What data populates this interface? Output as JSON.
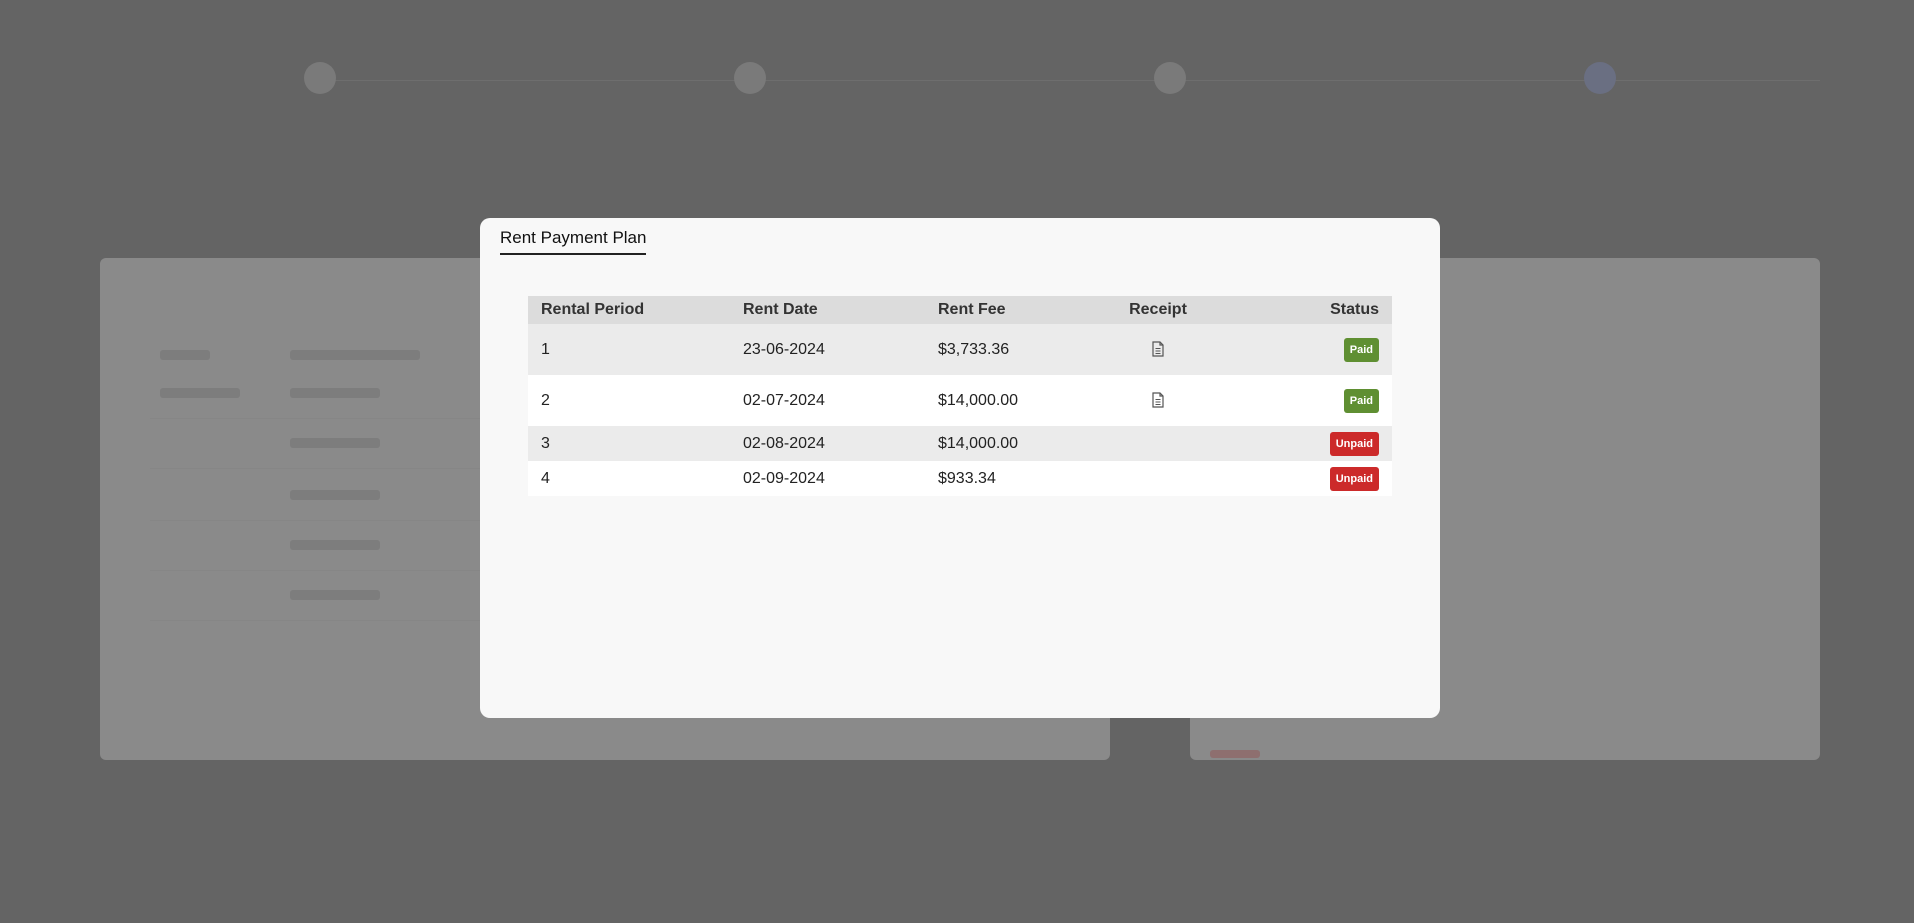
{
  "modal": {
    "title": "Rent Payment Plan"
  },
  "table": {
    "headers": {
      "period": "Rental Period",
      "date": "Rent Date",
      "fee": "Rent Fee",
      "receipt": "Receipt",
      "status": "Status"
    },
    "rows": [
      {
        "period": "1",
        "date": "23-06-2024",
        "fee": "$3,733.36",
        "receipt_icon": "document-icon",
        "status": "Paid"
      },
      {
        "period": "2",
        "date": "02-07-2024",
        "fee": "$14,000.00",
        "receipt_icon": "document-icon",
        "status": "Paid"
      },
      {
        "period": "3",
        "date": "02-08-2024",
        "fee": "$14,000.00",
        "receipt_icon": "",
        "status": "Unpaid"
      },
      {
        "period": "4",
        "date": "02-09-2024",
        "fee": "$933.34",
        "receipt_icon": "",
        "status": "Unpaid"
      }
    ]
  },
  "colors": {
    "paid": "#5f8f32",
    "unpaid": "#cc2a2a",
    "overlay": "#646464",
    "dialog_bg": "#f8f8f8"
  }
}
